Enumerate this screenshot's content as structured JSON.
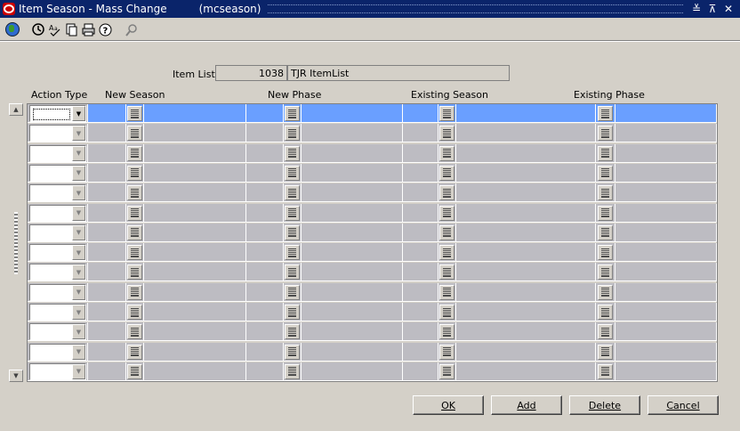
{
  "window": {
    "title": "Item Season - Mass Change",
    "form_code": "(mcseason)",
    "controls": [
      "≚",
      "⊼",
      "✕"
    ]
  },
  "toolbar": {
    "icons": [
      "globe-icon",
      "help-icon",
      "spell-check-icon",
      "copy-icon",
      "print-icon",
      "question-icon",
      "search-icon"
    ]
  },
  "item_list": {
    "label": "Item List",
    "number": "1038",
    "name": "TJR ItemList"
  },
  "grid": {
    "columns": [
      "Action Type",
      "New Season",
      "New Phase",
      "Existing Season",
      "Existing Phase"
    ],
    "row_count": 14,
    "selected_row": 0
  },
  "buttons": {
    "ok": "OK",
    "add": "Add",
    "delete": "Delete",
    "cancel": "Cancel"
  }
}
